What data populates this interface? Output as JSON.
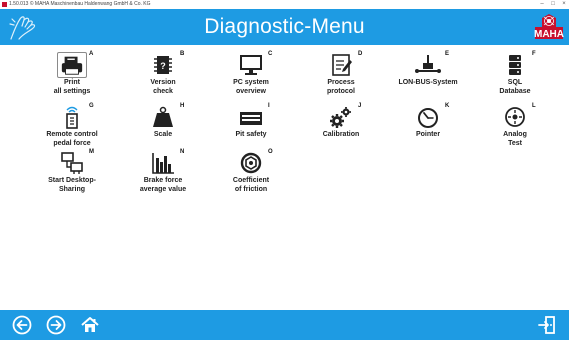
{
  "window": {
    "title": "1.50.013  © MAHA Maschinenbau Haldenwang GmbH & Co. KG",
    "minimize": "–",
    "maximize": "□",
    "close": "×"
  },
  "header": {
    "title": "Diagnostic-Menu",
    "logo_text": "MAHA",
    "brand_color": "#1e9be3",
    "logo_color": "#c8102e"
  },
  "menu": {
    "items": [
      {
        "letter": "A",
        "label": "Print\nall settings",
        "icon": "printer-icon"
      },
      {
        "letter": "B",
        "label": "Version\ncheck",
        "icon": "version-check-icon"
      },
      {
        "letter": "C",
        "label": "PC system\noverview",
        "icon": "monitor-icon"
      },
      {
        "letter": "D",
        "label": "Process\nprotocol",
        "icon": "protocol-icon"
      },
      {
        "letter": "E",
        "label": "LON-BUS-System",
        "icon": "network-icon"
      },
      {
        "letter": "F",
        "label": "SQL\nDatabase",
        "icon": "database-icon"
      },
      {
        "letter": "G",
        "label": "Remote control\npedal force",
        "icon": "remote-control-icon"
      },
      {
        "letter": "H",
        "label": "Scale",
        "icon": "weight-icon"
      },
      {
        "letter": "I",
        "label": "Pit safety",
        "icon": "pit-safety-icon"
      },
      {
        "letter": "J",
        "label": "Calibration",
        "icon": "gears-icon"
      },
      {
        "letter": "K",
        "label": "Pointer",
        "icon": "gauge-icon"
      },
      {
        "letter": "L",
        "label": "Analog\nTest",
        "icon": "analog-test-icon"
      },
      {
        "letter": "M",
        "label": "Start Desktop-\nSharing",
        "icon": "desktop-sharing-icon"
      },
      {
        "letter": "N",
        "label": "Brake force\naverage value",
        "icon": "bar-chart-icon"
      },
      {
        "letter": "O",
        "label": "Coefficient\nof friction",
        "icon": "friction-icon"
      }
    ]
  },
  "footer": {
    "back": "back-icon",
    "forward": "forward-icon",
    "home": "home-icon",
    "exit": "exit-icon"
  }
}
